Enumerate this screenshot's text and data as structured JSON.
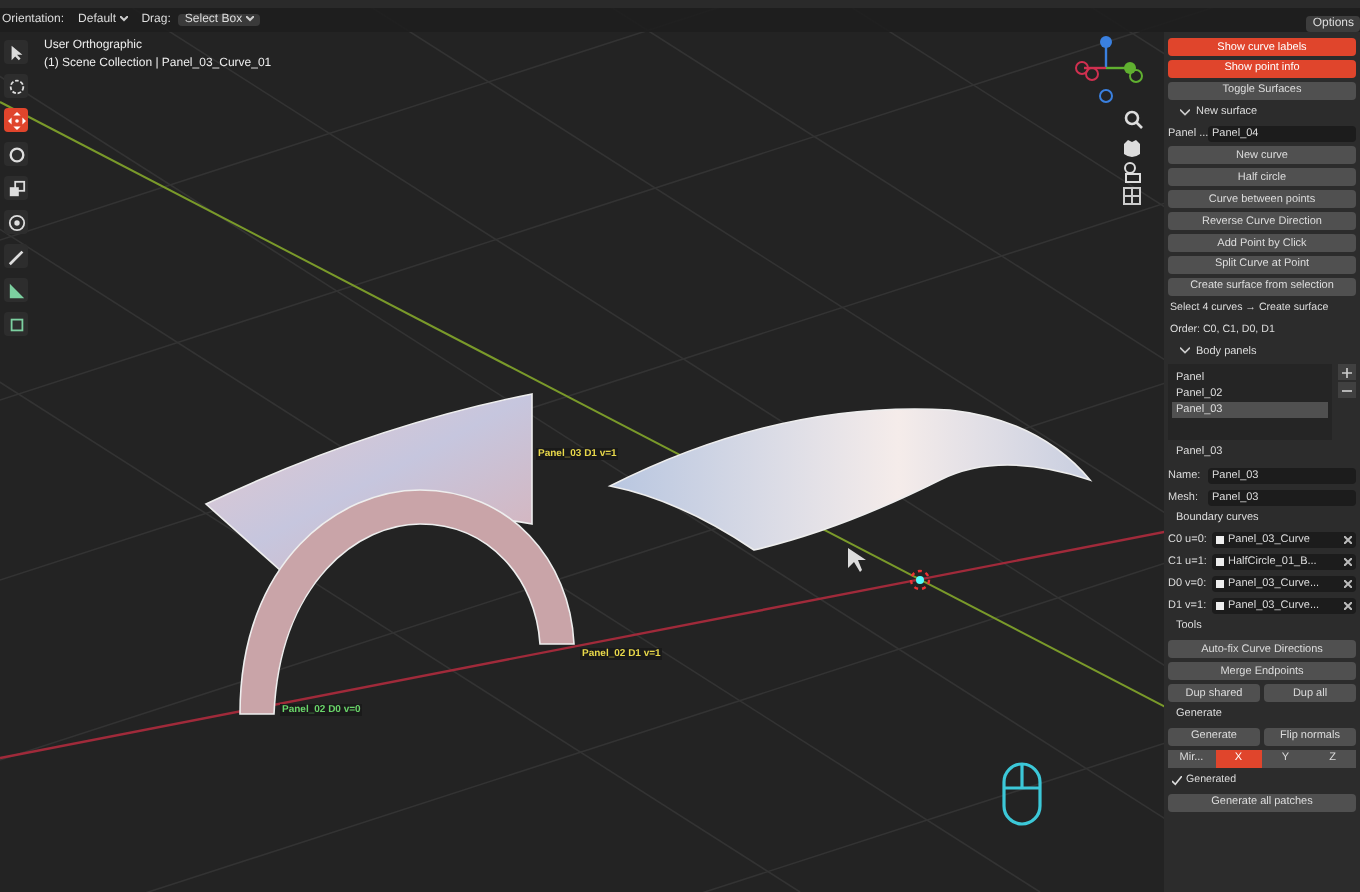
{
  "header": {
    "orientation_label": "Orientation:",
    "orientation_value": "Default",
    "drag_label": "Drag:",
    "drag_value": "Select Box"
  },
  "overlay": {
    "view_name": "User Orthographic",
    "context": "(1) Scene Collection | Panel_03_Curve_01"
  },
  "options_button": "Options",
  "tools": [
    {
      "kind": "select",
      "selected": false
    },
    {
      "kind": "cursor",
      "selected": false
    },
    {
      "kind": "move",
      "selected": true
    },
    {
      "kind": "rotate",
      "selected": false
    },
    {
      "kind": "scale",
      "selected": false
    },
    {
      "kind": "transform",
      "selected": false
    },
    {
      "kind": "annotate",
      "selected": false
    },
    {
      "kind": "measure",
      "selected": false
    },
    {
      "kind": "add-cube",
      "selected": false
    }
  ],
  "viewport_labels": [
    {
      "text": "Panel_03 D1 v=1",
      "color": "#e8d84a"
    },
    {
      "text": "Panel_02 D1 v=1",
      "color": "#e8d84a"
    },
    {
      "text": "Panel_02 D0 v=0",
      "color": "#6ad66a"
    }
  ],
  "sidebar": {
    "items": [
      {
        "kind": "toggle",
        "label": "Show curve labels",
        "on": true
      },
      {
        "kind": "toggle",
        "label": "Show point info",
        "on": true
      },
      {
        "kind": "button",
        "label": "Toggle Surfaces"
      },
      {
        "kind": "section",
        "label": "New surface",
        "expanded": true
      },
      {
        "kind": "field",
        "label": "Panel ...",
        "value": "Panel_04"
      },
      {
        "kind": "button",
        "label": "New curve"
      },
      {
        "kind": "button",
        "label": "Half circle"
      },
      {
        "kind": "button",
        "label": "Curve between points"
      },
      {
        "kind": "button",
        "label": "Reverse Curve Direction"
      },
      {
        "kind": "button",
        "label": "Add Point by Click"
      },
      {
        "kind": "button",
        "label": "Split Curve at Point"
      },
      {
        "kind": "button",
        "label": "Create surface from selection"
      },
      {
        "kind": "text",
        "label": "Select 4 curves → Create surface"
      },
      {
        "kind": "text",
        "label": "Order: C0, C1, D0, D1"
      },
      {
        "kind": "section",
        "label": "Body panels",
        "expanded": true
      },
      {
        "kind": "list",
        "entries": [
          {
            "label": "Panel",
            "selected": false
          },
          {
            "label": "Panel_02",
            "selected": false
          },
          {
            "label": "Panel_03",
            "selected": true
          }
        ]
      },
      {
        "kind": "subheader",
        "label": "Panel_03"
      },
      {
        "kind": "field",
        "label": "Name:",
        "value": "Panel_03"
      },
      {
        "kind": "field",
        "label": "Mesh:",
        "value": "Panel_03"
      },
      {
        "kind": "subheader",
        "label": "Boundary curves"
      },
      {
        "kind": "curve",
        "slot": "C0 u=0:",
        "value": "Panel_03_Curve"
      },
      {
        "kind": "curve",
        "slot": "C1 u=1:",
        "value": "HalfCircle_01_B..."
      },
      {
        "kind": "curve",
        "slot": "D0 v=0:",
        "value": "Panel_03_Curve..."
      },
      {
        "kind": "curve",
        "slot": "D1 v=1:",
        "value": "Panel_03_Curve..."
      },
      {
        "kind": "subheader",
        "label": "Tools"
      },
      {
        "kind": "button",
        "label": "Auto-fix Curve Directions"
      },
      {
        "kind": "button",
        "label": "Merge Endpoints"
      },
      {
        "kind": "pair",
        "buttons": [
          "Dup shared",
          "Dup all"
        ]
      },
      {
        "kind": "subheader",
        "label": "Generate"
      },
      {
        "kind": "pair",
        "buttons": [
          "Generate",
          "Flip normals"
        ]
      },
      {
        "kind": "mirror",
        "label": "Mir...",
        "axes": [
          {
            "label": "X",
            "selected": true
          },
          {
            "label": "Y",
            "selected": false
          },
          {
            "label": "Z",
            "selected": false
          }
        ]
      },
      {
        "kind": "check",
        "label": "Generated",
        "checked": true
      },
      {
        "kind": "button",
        "label": "Generate all patches"
      }
    ]
  }
}
